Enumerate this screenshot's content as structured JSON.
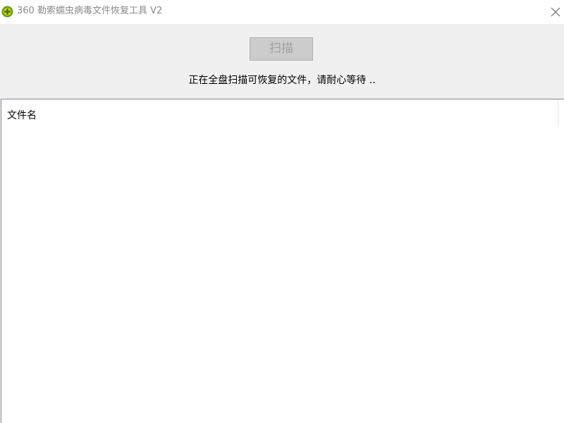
{
  "window": {
    "title": "360 勒索蠕虫病毒文件恢复工具 V2",
    "close_glyph": "╳"
  },
  "toolbar": {
    "scan_label": "扫描",
    "scan_enabled": false
  },
  "status_text": "正在全盘扫描可恢复的文件，请耐心等待 ..",
  "file_list": {
    "columns": [
      "文件名"
    ],
    "rows": []
  },
  "icons": {
    "app_icon": "360-logo-icon",
    "close": "close-icon"
  },
  "colors": {
    "title_text": "#8a8a8a",
    "window_bg": "#f0f0f0",
    "disabled_button_bg": "#cccccc",
    "logo_green": "#5aa51c",
    "logo_yellow": "#f2c500"
  }
}
